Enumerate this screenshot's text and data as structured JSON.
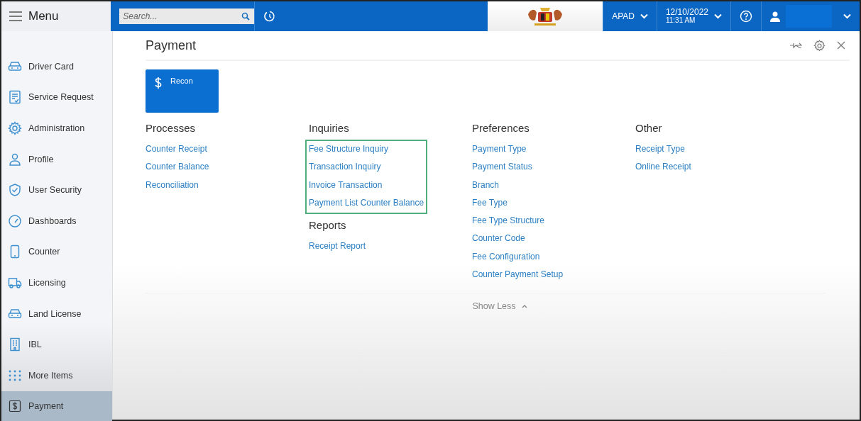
{
  "menu": {
    "label": "Menu"
  },
  "search": {
    "placeholder": "Search..."
  },
  "header": {
    "branch": "APAD",
    "date": "12/10/2022",
    "time": "11:31 AM"
  },
  "sidebar": {
    "items": [
      {
        "label": "Driver Card",
        "kind": "car",
        "selected": false
      },
      {
        "label": "Service Request",
        "kind": "form",
        "selected": false
      },
      {
        "label": "Administration",
        "kind": "gear",
        "selected": false
      },
      {
        "label": "Profile",
        "kind": "person",
        "selected": false
      },
      {
        "label": "User Security",
        "kind": "shield",
        "selected": false
      },
      {
        "label": "Dashboards",
        "kind": "gauge",
        "selected": false
      },
      {
        "label": "Counter",
        "kind": "phone",
        "selected": false
      },
      {
        "label": "Licensing",
        "kind": "truck",
        "selected": false
      },
      {
        "label": "Land License",
        "kind": "car",
        "selected": false
      },
      {
        "label": "IBL",
        "kind": "building",
        "selected": false
      },
      {
        "label": "More Items",
        "kind": "dots",
        "selected": false
      },
      {
        "label": "Payment",
        "kind": "dollar",
        "selected": true
      }
    ]
  },
  "page": {
    "title": "Payment",
    "tiles": [
      {
        "label": "Recon"
      }
    ],
    "columns": [
      {
        "groups": [
          {
            "title": "Processes",
            "highlighted": false,
            "links": [
              "Counter Receipt",
              "Counter Balance",
              "Reconciliation"
            ]
          }
        ]
      },
      {
        "groups": [
          {
            "title": "Inquiries",
            "highlighted": true,
            "links": [
              "Fee Structure Inquiry",
              "Transaction Inquiry",
              "Invoice Transaction",
              "Payment List Counter Balance"
            ]
          },
          {
            "title": "Reports",
            "highlighted": false,
            "links": [
              "Receipt Report"
            ]
          }
        ]
      },
      {
        "groups": [
          {
            "title": "Preferences",
            "highlighted": false,
            "links": [
              "Payment Type",
              "Payment Status",
              "Branch",
              "Fee Type",
              "Fee Type Structure",
              "Counter Code",
              "Fee Configuration",
              "Counter Payment Setup"
            ]
          }
        ]
      },
      {
        "groups": [
          {
            "title": "Other",
            "highlighted": false,
            "links": [
              "Receipt Type",
              "Online Receipt"
            ]
          }
        ]
      }
    ],
    "show_less": "Show Less"
  }
}
